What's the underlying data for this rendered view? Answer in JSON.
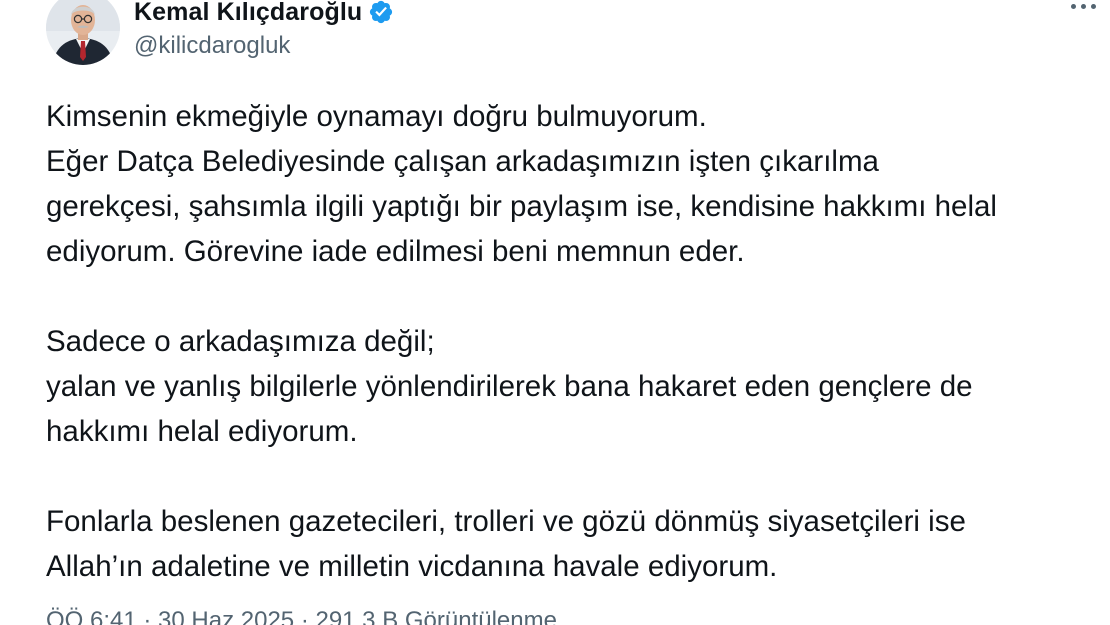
{
  "author": {
    "display_name": "Kemal Kılıçdaroğlu",
    "handle": "@kilicdarogluk",
    "verified": true,
    "verified_icon": "verified-badge-icon",
    "verified_color": "#1d9bf0"
  },
  "menu_icon": "more-options-icon",
  "tweet": {
    "lines": [
      "Kimsenin ekmeğiyle oynamayı doğru bulmuyorum.",
      "Eğer Datça Belediyesinde çalışan arkadaşımızın işten çıkarılma",
      "gerekçesi, şahsımla ilgili yaptığı bir paylaşım ise, kendisine hakkımı helal",
      "ediyorum. Görevine iade edilmesi beni memnun eder.",
      "",
      "Sadece o arkadaşımıza değil;",
      "yalan ve yanlış bilgilerle yönlendirilerek bana hakaret eden gençlere de",
      "hakkımı helal ediyorum.",
      "",
      "Fonlarla beslenen gazetecileri, trolleri ve gözü dönmüş siyasetçileri ise",
      "Allah’ın adaletine ve milletin vicdanına havale ediyorum."
    ]
  },
  "meta": {
    "text": "ÖÖ 6:41 · 30 Haz 2025 · 291,3 B Görüntülenme"
  },
  "colors": {
    "text": "#0f1419",
    "secondary": "#536471",
    "background": "#ffffff"
  }
}
